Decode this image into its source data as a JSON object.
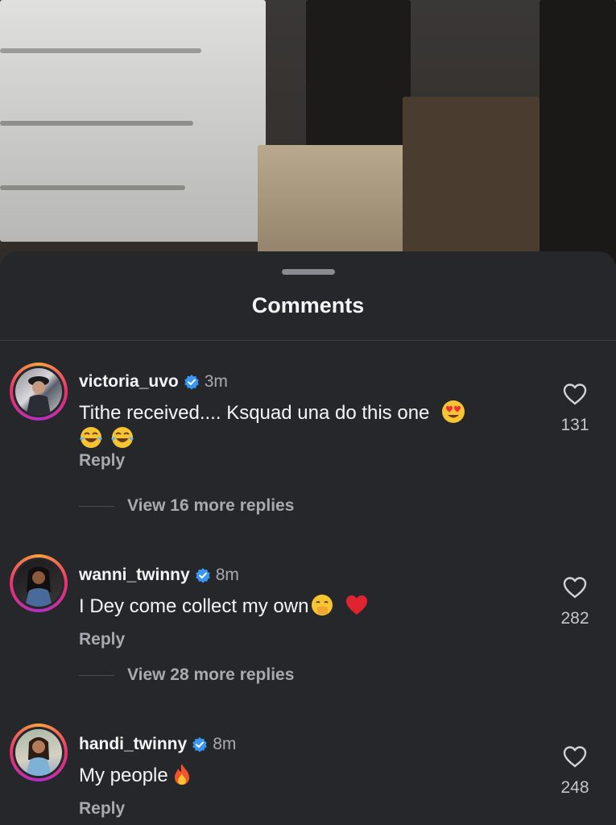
{
  "video": {
    "description_icon": "video-frame"
  },
  "sheet": {
    "title": "Comments"
  },
  "comments": [
    {
      "username": "victoria_uvo",
      "verified": true,
      "time": "3m",
      "text": "Tithe received.... Ksquad una do this one",
      "emojis_inline": [
        "heart-eyes-emoji"
      ],
      "emojis_line2": [
        "tears-of-joy-emoji",
        "tears-of-joy-emoji"
      ],
      "reply_label": "Reply",
      "likes": "131",
      "view_replies": "View 16 more replies"
    },
    {
      "username": "wanni_twinny",
      "verified": true,
      "time": "8m",
      "text": "I Dey come collect my own",
      "emojis_inline": [
        "hand-over-mouth-emoji",
        "red-heart-emoji"
      ],
      "reply_label": "Reply",
      "likes": "282",
      "view_replies": "View 28 more replies"
    },
    {
      "username": "handi_twinny",
      "verified": true,
      "time": "8m",
      "text": "My people",
      "emojis_inline": [
        "fire-emoji"
      ],
      "reply_label": "Reply",
      "likes": "248"
    }
  ],
  "colors": {
    "sheet_bg": "#26272b",
    "verified_blue": "#3897f0",
    "story_ring_start": "#f9a23b",
    "story_ring_end": "#b12fc5"
  }
}
